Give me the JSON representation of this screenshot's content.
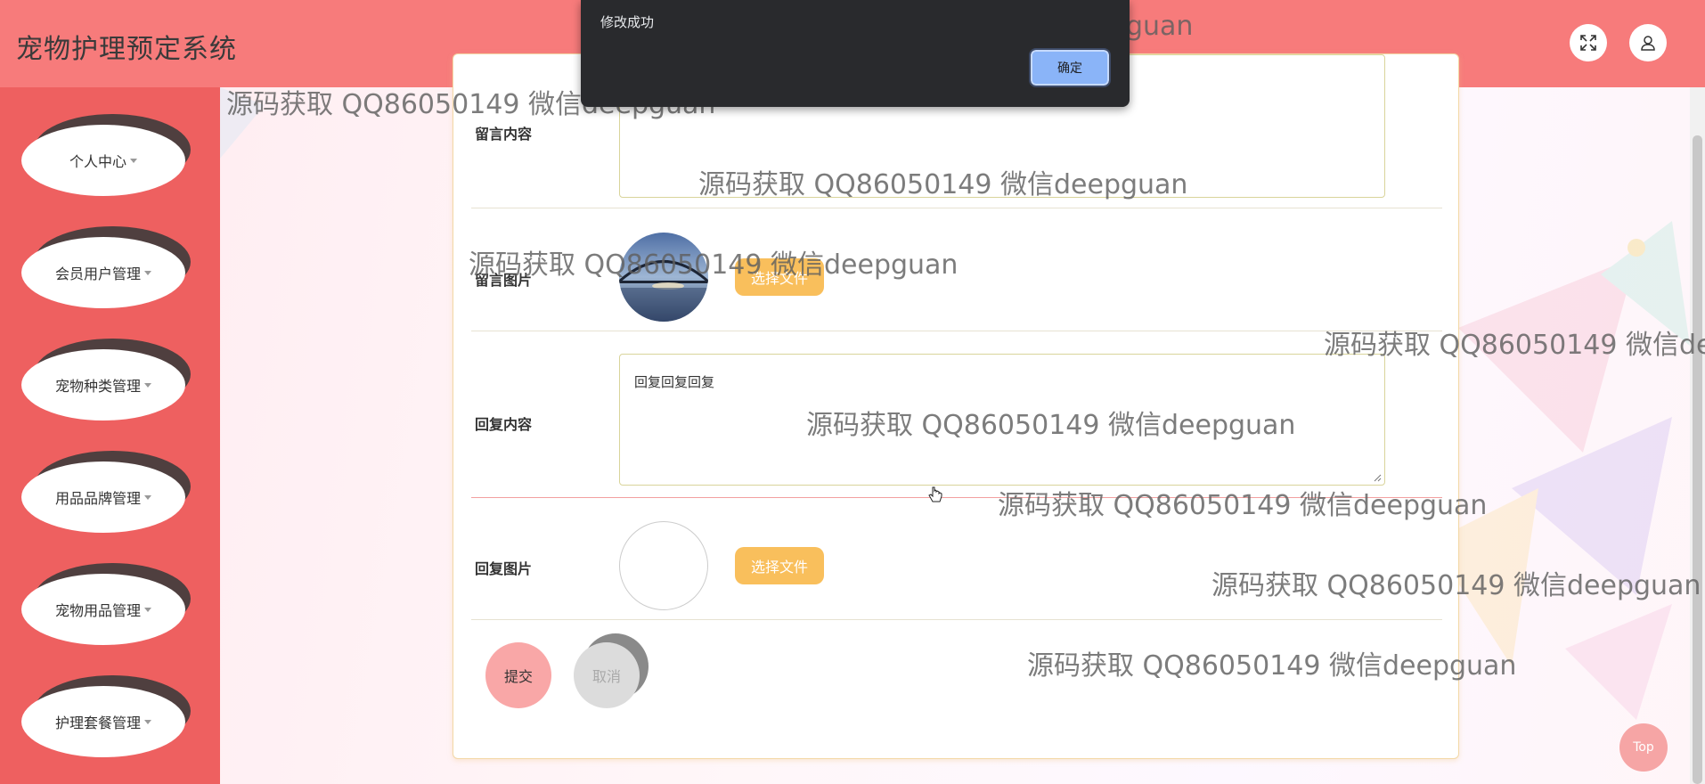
{
  "app": {
    "title": "宠物护理预定系统"
  },
  "header": {
    "fullscreen_icon": "fullscreen-icon",
    "user_icon": "user-icon"
  },
  "sidebar": {
    "items": [
      {
        "label": "个人中心"
      },
      {
        "label": "会员用户管理"
      },
      {
        "label": "宠物种类管理"
      },
      {
        "label": "用品品牌管理"
      },
      {
        "label": "宠物用品管理"
      },
      {
        "label": "护理套餐管理"
      }
    ]
  },
  "form": {
    "message_content": {
      "label": "留言内容",
      "value": ""
    },
    "message_image": {
      "label": "留言图片",
      "button": "选择文件"
    },
    "reply_content": {
      "label": "回复内容",
      "value": "回复回复回复"
    },
    "reply_image": {
      "label": "回复图片",
      "button": "选择文件"
    },
    "submit": "提交",
    "cancel": "取消"
  },
  "top_button": "Top",
  "dialog": {
    "message": "修改成功",
    "ok": "确定"
  },
  "watermark": "源码获取 QQ86050149 微信deepguan",
  "colors": {
    "header": "#f77b7b",
    "sidebar": "#ee6060",
    "file_button": "#f9bf5c",
    "submit": "#f9a7a7",
    "dialog": "#292a2d",
    "dialog_ok": "#8ab4f8"
  }
}
